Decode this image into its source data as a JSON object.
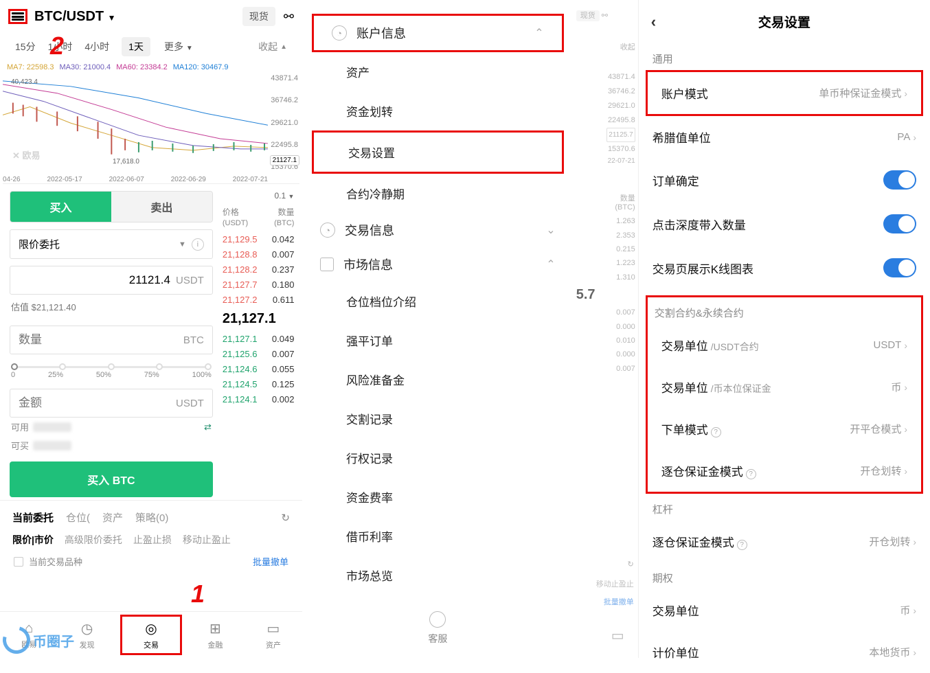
{
  "panel1": {
    "pair": "BTC/USDT",
    "spot": "现货",
    "timeframes": {
      "t15": "15分",
      "t1h": "1小时",
      "t4h": "4小时",
      "t1d": "1天",
      "more": "更多"
    },
    "collapse": "收起",
    "ma": {
      "ma7": "MA7: 22598.3",
      "ma30": "MA30: 21000.4",
      "ma60": "MA60: 23384.2",
      "ma120": "MA120: 30467.9"
    },
    "chart": {
      "ylabels": [
        "43871.4",
        "36746.2",
        "29621.0",
        "22495.8",
        "15370.6"
      ],
      "current": "21127.1",
      "xlabels": [
        "04-26",
        "2022-05-17",
        "2022-06-07",
        "2022-06-29",
        "2022-07-21"
      ],
      "peak": "40,423.4",
      "trough": "17,618.0",
      "watermark": "✕ 欧易"
    },
    "trade": {
      "buy": "买入",
      "sell": "卖出",
      "order_type": "限价委托",
      "price": "21121.4",
      "price_unit": "USDT",
      "est": "估值 $21,121.40",
      "qty_ph": "数量",
      "qty_unit": "BTC",
      "slider": [
        "0",
        "25%",
        "50%",
        "75%",
        "100%"
      ],
      "amt_ph": "金额",
      "amt_unit": "USDT",
      "avail": "可用",
      "canbuy": "可买",
      "buy_btn": "买入 BTC"
    },
    "orderbook": {
      "sel": "0.1",
      "h1": "价格",
      "h1u": "(USDT)",
      "h2": "数量",
      "h2u": "(BTC)",
      "asks": [
        {
          "p": "21,129.5",
          "q": "0.042"
        },
        {
          "p": "21,128.8",
          "q": "0.007"
        },
        {
          "p": "21,128.2",
          "q": "0.237"
        },
        {
          "p": "21,127.7",
          "q": "0.180"
        },
        {
          "p": "21,127.2",
          "q": "0.611"
        }
      ],
      "mid": "21,127.1",
      "bids": [
        {
          "p": "21,127.1",
          "q": "0.049"
        },
        {
          "p": "21,125.6",
          "q": "0.007"
        },
        {
          "p": "21,124.6",
          "q": "0.055"
        },
        {
          "p": "21,124.5",
          "q": "0.125"
        },
        {
          "p": "21,124.1",
          "q": "0.002"
        }
      ]
    },
    "pos": {
      "cur": "当前委托",
      "pos": "仓位",
      "asset": "资产",
      "strat": "策略(0)"
    },
    "filters": {
      "lm": "限价|市价",
      "adv": "高级限价委托",
      "sl": "止盈止损",
      "mv": "移动止盈止"
    },
    "only_cur": "当前交易品种",
    "batch_cancel": "批量撤单",
    "nav": {
      "home": "欧易",
      "disc": "发现",
      "trade": "交易",
      "fin": "金融",
      "asset": "资产"
    },
    "anno1": "1",
    "anno2": "2"
  },
  "panel2": {
    "sec_account": "账户信息",
    "items_a": [
      "资产",
      "资金划转",
      "交易设置",
      "合约冷静期"
    ],
    "sec_trade": "交易信息",
    "sec_market": "市场信息",
    "items_m": [
      "仓位档位介绍",
      "强平订单",
      "风险准备金",
      "交割记录",
      "行权记录",
      "资金费率",
      "借币利率",
      "市场总览"
    ],
    "support": "客服"
  },
  "ghost": {
    "spot": "现货",
    "collapse": "收起",
    "ylabels": [
      "43871.4",
      "36746.2",
      "29621.0",
      "22495.8",
      "15370.6"
    ],
    "current": "21125.7",
    "xdate": "22-07-21",
    "h2": "数量",
    "h2u": "(BTC)",
    "qty": [
      "1.263",
      "2.353",
      "0.215",
      "1.223",
      "1.310"
    ],
    "mid": "5.7",
    "bq": [
      "0.007",
      "0.000",
      "0.010",
      "0.000",
      "0.007"
    ],
    "mv": "移动止盈止",
    "batch": "批量撤单"
  },
  "panel3": {
    "title": "交易设置",
    "sec_general": "通用",
    "acct_mode": "账户模式",
    "acct_mode_v": "单币种保证金模式",
    "greek": "希腊值单位",
    "greek_v": "PA",
    "confirm": "订单确定",
    "depth": "点击深度带入数量",
    "kline": "交易页展示K线图表",
    "sec_contract": "交割合约&永续合约",
    "unit1": "交易单位",
    "unit1_sub": "/USDT合约",
    "unit1_v": "USDT",
    "unit2": "交易单位",
    "unit2_sub": "/币本位保证金",
    "unit2_v": "币",
    "order_mode": "下单模式",
    "order_mode_v": "开平仓模式",
    "iso1": "逐仓保证金模式",
    "iso1_v": "开仓划转",
    "sec_lever": "杠杆",
    "iso2": "逐仓保证金模式",
    "iso2_v": "开仓划转",
    "sec_option": "期权",
    "opt_unit": "交易单位",
    "opt_unit_v": "币",
    "quote_unit": "计价单位",
    "quote_unit_v": "本地货币"
  },
  "watermark": "币圈子"
}
